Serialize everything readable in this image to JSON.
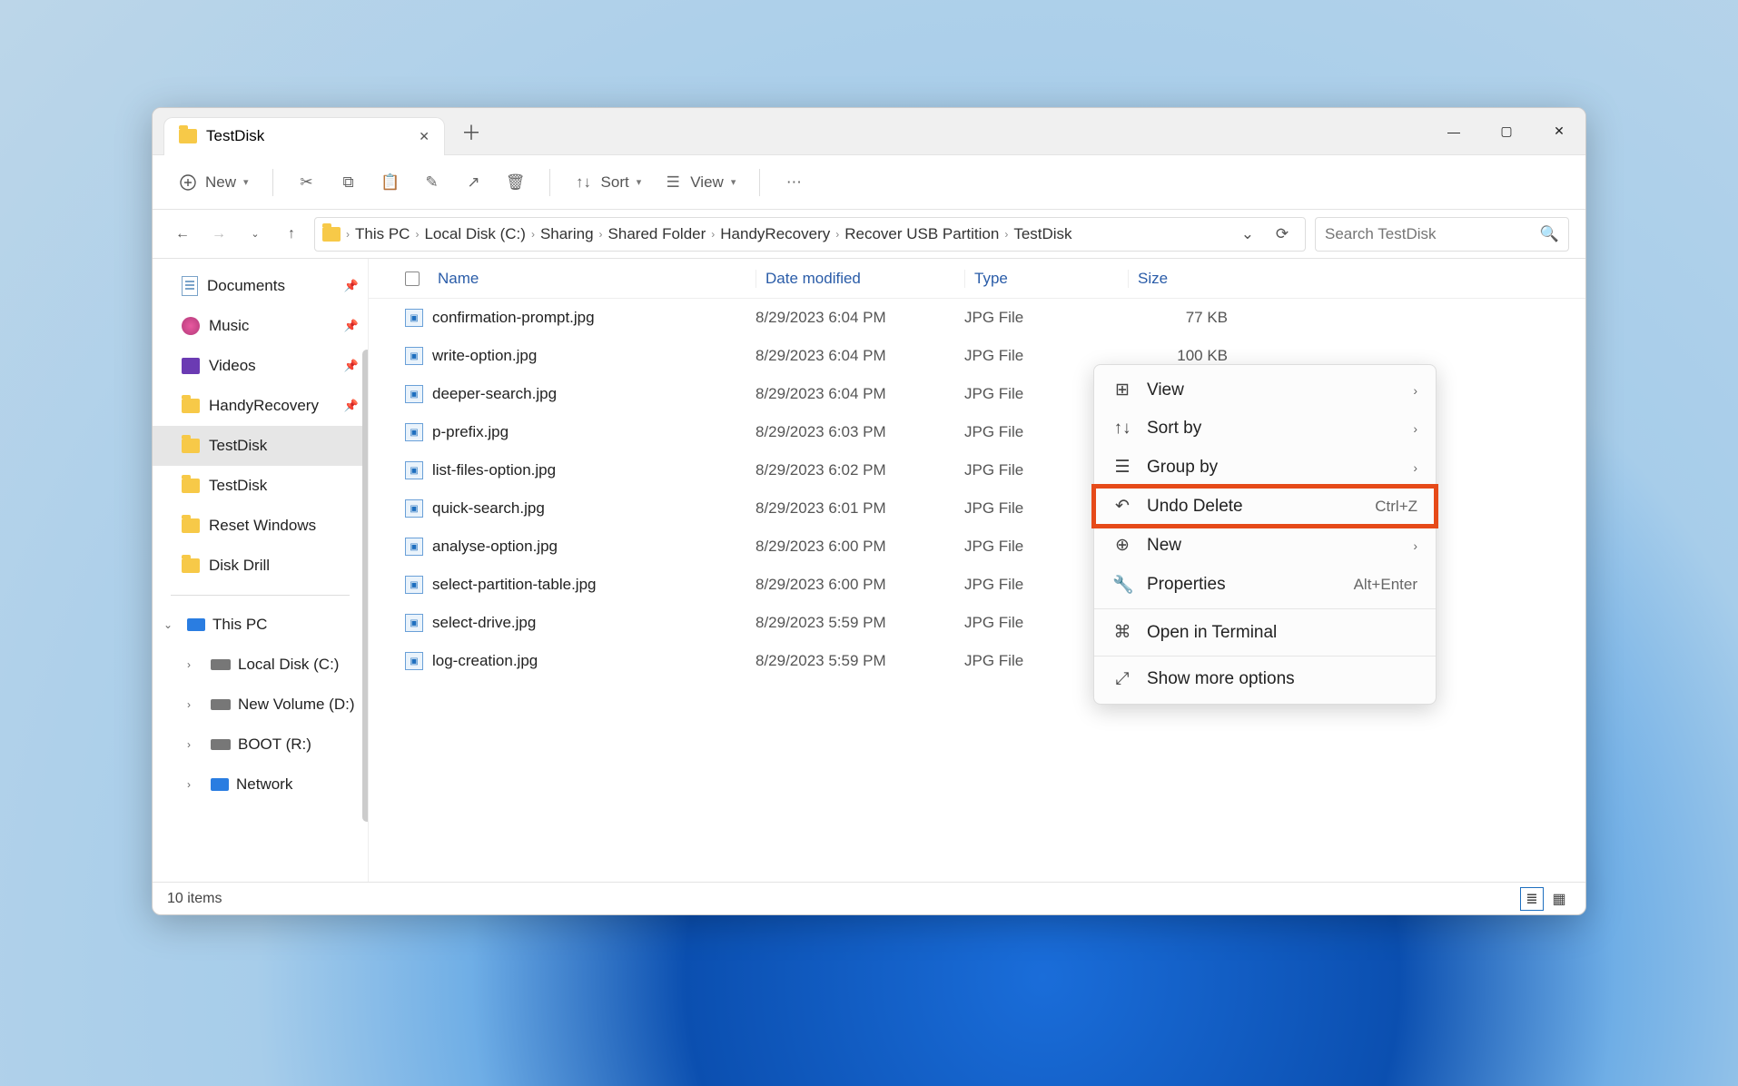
{
  "tab": {
    "title": "TestDisk"
  },
  "toolbar": {
    "new": "New",
    "sort": "Sort",
    "view": "View"
  },
  "breadcrumb": [
    "This PC",
    "Local Disk (C:)",
    "Sharing",
    "Shared Folder",
    "HandyRecovery",
    "Recover USB Partition",
    "TestDisk"
  ],
  "search": {
    "placeholder": "Search TestDisk"
  },
  "columns": {
    "name": "Name",
    "date": "Date modified",
    "type": "Type",
    "size": "Size"
  },
  "sidebar": {
    "quick": [
      {
        "label": "Documents",
        "icon": "doc",
        "pin": true
      },
      {
        "label": "Music",
        "icon": "music",
        "pin": true
      },
      {
        "label": "Videos",
        "icon": "video",
        "pin": true
      },
      {
        "label": "HandyRecovery",
        "icon": "folder",
        "pin": true
      },
      {
        "label": "TestDisk",
        "icon": "folder",
        "pin": false,
        "selected": true
      },
      {
        "label": "TestDisk",
        "icon": "folder",
        "pin": false
      },
      {
        "label": "Reset Windows",
        "icon": "folder",
        "pin": false
      },
      {
        "label": "Disk Drill",
        "icon": "folder",
        "pin": false
      }
    ],
    "tree": [
      {
        "label": "This PC",
        "icon": "pc",
        "expanded": true
      },
      {
        "label": "Local Disk (C:)",
        "icon": "drive",
        "indent": 1
      },
      {
        "label": "New Volume (D:)",
        "icon": "drive",
        "indent": 1
      },
      {
        "label": "BOOT (R:)",
        "icon": "drive",
        "indent": 1
      },
      {
        "label": "Network",
        "icon": "pc",
        "indent": 1
      }
    ]
  },
  "files": [
    {
      "name": "confirmation-prompt.jpg",
      "date": "8/29/2023 6:04 PM",
      "type": "JPG File",
      "size": "77 KB"
    },
    {
      "name": "write-option.jpg",
      "date": "8/29/2023 6:04 PM",
      "type": "JPG File",
      "size": "100 KB"
    },
    {
      "name": "deeper-search.jpg",
      "date": "8/29/2023 6:04 PM",
      "type": "JPG File",
      "size": ""
    },
    {
      "name": "p-prefix.jpg",
      "date": "8/29/2023 6:03 PM",
      "type": "JPG File",
      "size": ""
    },
    {
      "name": "list-files-option.jpg",
      "date": "8/29/2023 6:02 PM",
      "type": "JPG File",
      "size": ""
    },
    {
      "name": "quick-search.jpg",
      "date": "8/29/2023 6:01 PM",
      "type": "JPG File",
      "size": ""
    },
    {
      "name": "analyse-option.jpg",
      "date": "8/29/2023 6:00 PM",
      "type": "JPG File",
      "size": ""
    },
    {
      "name": "select-partition-table.jpg",
      "date": "8/29/2023 6:00 PM",
      "type": "JPG File",
      "size": ""
    },
    {
      "name": "select-drive.jpg",
      "date": "8/29/2023 5:59 PM",
      "type": "JPG File",
      "size": ""
    },
    {
      "name": "log-creation.jpg",
      "date": "8/29/2023 5:59 PM",
      "type": "JPG File",
      "size": ""
    }
  ],
  "context": [
    {
      "label": "View",
      "icon": "grid",
      "sub": true
    },
    {
      "label": "Sort by",
      "icon": "sort",
      "sub": true
    },
    {
      "label": "Group by",
      "icon": "list",
      "sub": true
    },
    {
      "label": "Undo Delete",
      "icon": "undo",
      "shortcut": "Ctrl+Z",
      "highlight": true
    },
    {
      "label": "New",
      "icon": "plus",
      "sub": true
    },
    {
      "label": "Properties",
      "icon": "wrench",
      "shortcut": "Alt+Enter"
    },
    {
      "sep": true
    },
    {
      "label": "Open in Terminal",
      "icon": "terminal"
    },
    {
      "sep": true
    },
    {
      "label": "Show more options",
      "icon": "expand"
    }
  ],
  "status": {
    "text": "10 items"
  }
}
